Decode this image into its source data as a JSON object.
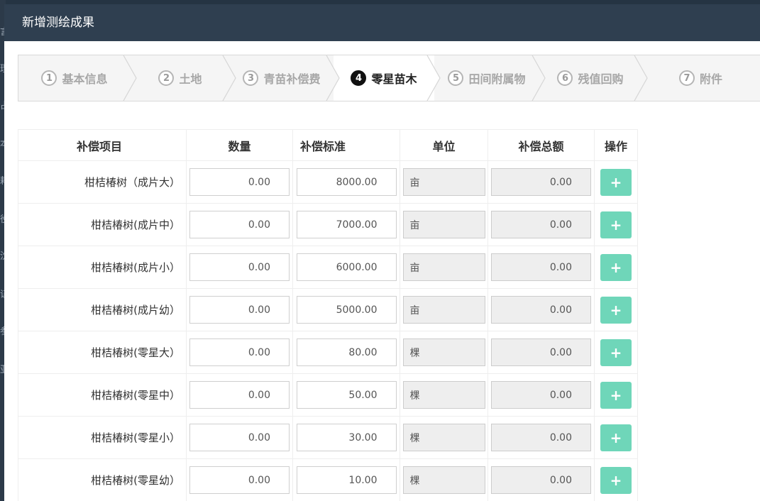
{
  "modal": {
    "title": "新增测绘成果"
  },
  "steps": [
    {
      "num": "1",
      "label": "基本信息"
    },
    {
      "num": "2",
      "label": "土地"
    },
    {
      "num": "3",
      "label": "青苗补偿费"
    },
    {
      "num": "4",
      "label": "零星苗木",
      "active": true
    },
    {
      "num": "5",
      "label": "田间附属物"
    },
    {
      "num": "6",
      "label": "残值回购"
    },
    {
      "num": "7",
      "label": "附件"
    }
  ],
  "table": {
    "headers": {
      "item": "补偿项目",
      "qty": "数量",
      "std": "补偿标准",
      "unit": "单位",
      "total": "补偿总额",
      "op": "操作"
    },
    "add_icon": "plus-icon",
    "rows": [
      {
        "item": "柑桔椿树（成片大）",
        "qty": "0.00",
        "std": "8000.00",
        "unit": "亩",
        "total": "0.00"
      },
      {
        "item": "柑桔椿树(成片中）",
        "qty": "0.00",
        "std": "7000.00",
        "unit": "亩",
        "total": "0.00"
      },
      {
        "item": "柑桔椿树(成片小）",
        "qty": "0.00",
        "std": "6000.00",
        "unit": "亩",
        "total": "0.00"
      },
      {
        "item": "柑桔椿树(成片幼）",
        "qty": "0.00",
        "std": "5000.00",
        "unit": "亩",
        "total": "0.00"
      },
      {
        "item": "柑桔椿树(零星大）",
        "qty": "0.00",
        "std": "80.00",
        "unit": "棵",
        "total": "0.00"
      },
      {
        "item": "柑桔椿树(零星中）",
        "qty": "0.00",
        "std": "50.00",
        "unit": "棵",
        "total": "0.00"
      },
      {
        "item": "柑桔椿树(零星小）",
        "qty": "0.00",
        "std": "30.00",
        "unit": "棵",
        "total": "0.00"
      },
      {
        "item": "柑桔椿树(零星幼）",
        "qty": "0.00",
        "std": "10.00",
        "unit": "棵",
        "total": "0.00"
      }
    ]
  },
  "background": {
    "side_chars": [
      "言",
      "理",
      "占",
      "本",
      "耜",
      "役",
      "沈",
      "证",
      "参",
      "亚"
    ]
  },
  "colors": {
    "header_bg": "#2f3f50",
    "add_button": "#6fd6b9",
    "active_step_num": "#111111"
  }
}
